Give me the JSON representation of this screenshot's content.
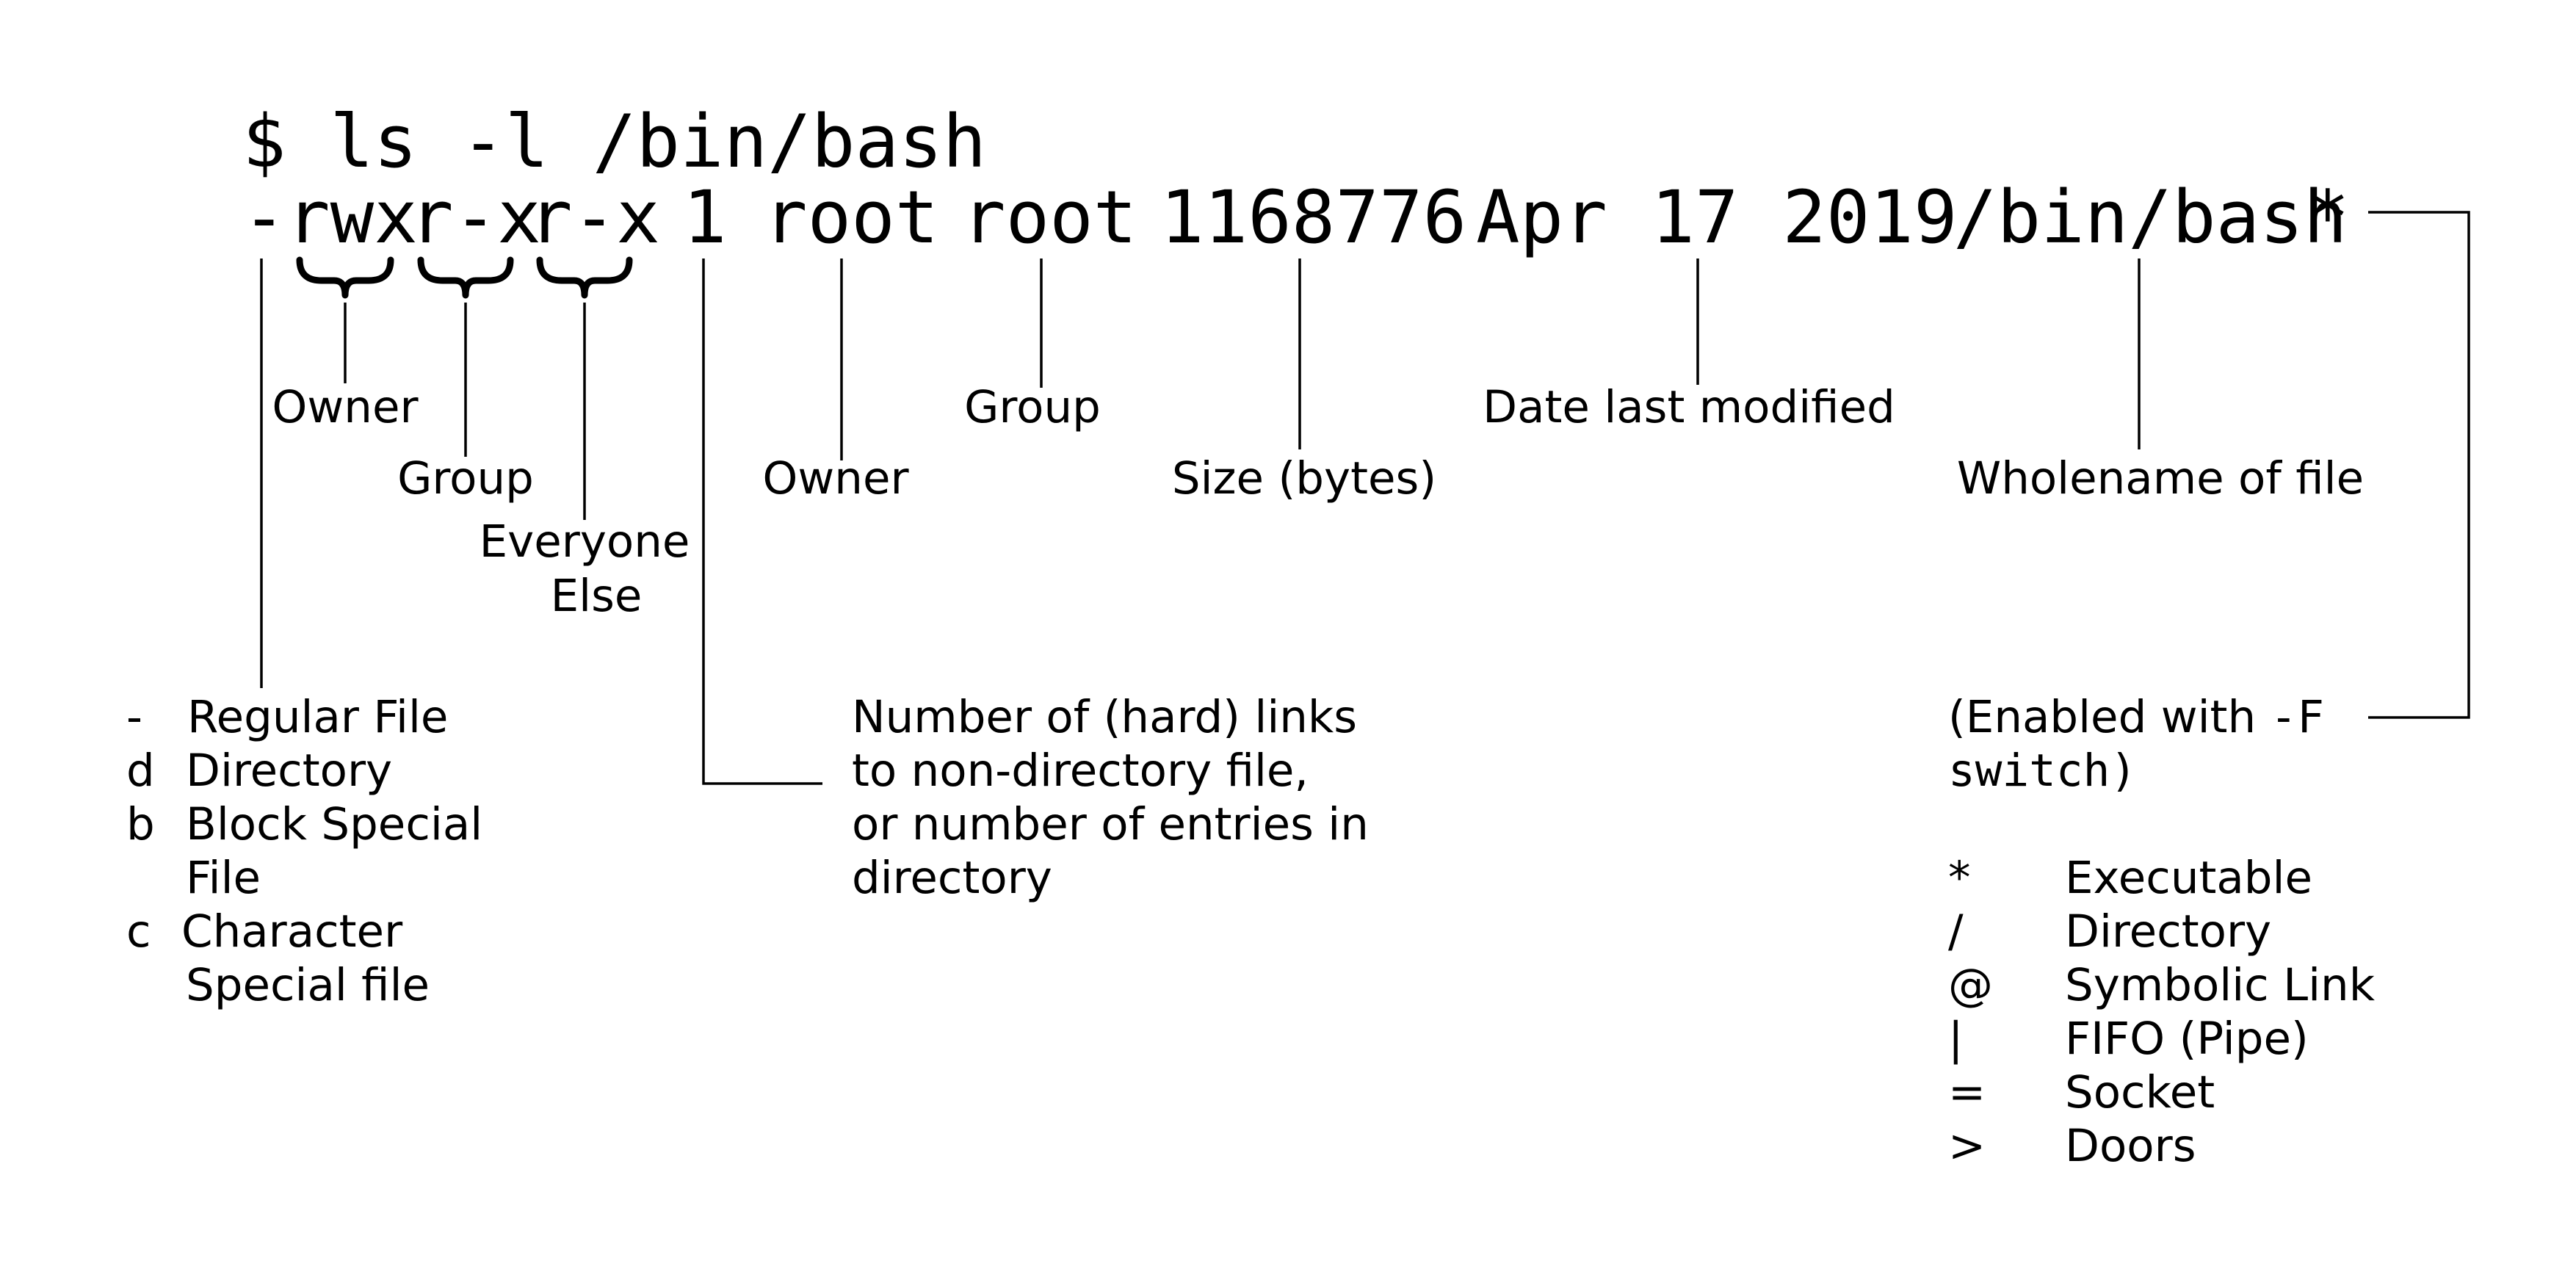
{
  "command": {
    "prompt_line": "$ ls -l /bin/bash",
    "file_type_char": "-",
    "perm_owner": "rwx",
    "perm_group": "r-x",
    "perm_everyone": "r-x",
    "link_count": "1",
    "owner": "root",
    "group": "root",
    "size": "1168776",
    "date": "Apr 17 2019",
    "filename": "/bin/bash",
    "indicator": "*"
  },
  "labels": {
    "perm_owner": "Owner",
    "perm_group": "Group",
    "perm_everyone_line1": "Everyone",
    "perm_everyone_line2": "Else",
    "owner": "Owner",
    "group": "Group",
    "size": "Size (bytes)",
    "date": "Date last modified",
    "filename": "Wholename of file"
  },
  "file_types": [
    {
      "code": "-",
      "desc": "Regular File"
    },
    {
      "code": "d",
      "desc": "Directory"
    },
    {
      "code": "b",
      "desc": "Block Special",
      "desc2": "File"
    },
    {
      "code": "c",
      "desc": "Character",
      "desc2": "Special file"
    }
  ],
  "links_note": [
    "Number of (hard) links",
    "to non-directory file,",
    "or number of entries in",
    "directory"
  ],
  "switch_note": {
    "prefix": "(Enabled with ",
    "flag": "-F",
    "line2": "switch)"
  },
  "indicators": [
    {
      "symbol": "*",
      "meaning": "Executable"
    },
    {
      "symbol": "/",
      "meaning": "Directory"
    },
    {
      "symbol": "@",
      "meaning": "Symbolic Link"
    },
    {
      "symbol": "|",
      "meaning": "FIFO (Pipe)"
    },
    {
      "symbol": "=",
      "meaning": "Socket"
    },
    {
      "symbol": ">",
      "meaning": "Doors"
    }
  ]
}
